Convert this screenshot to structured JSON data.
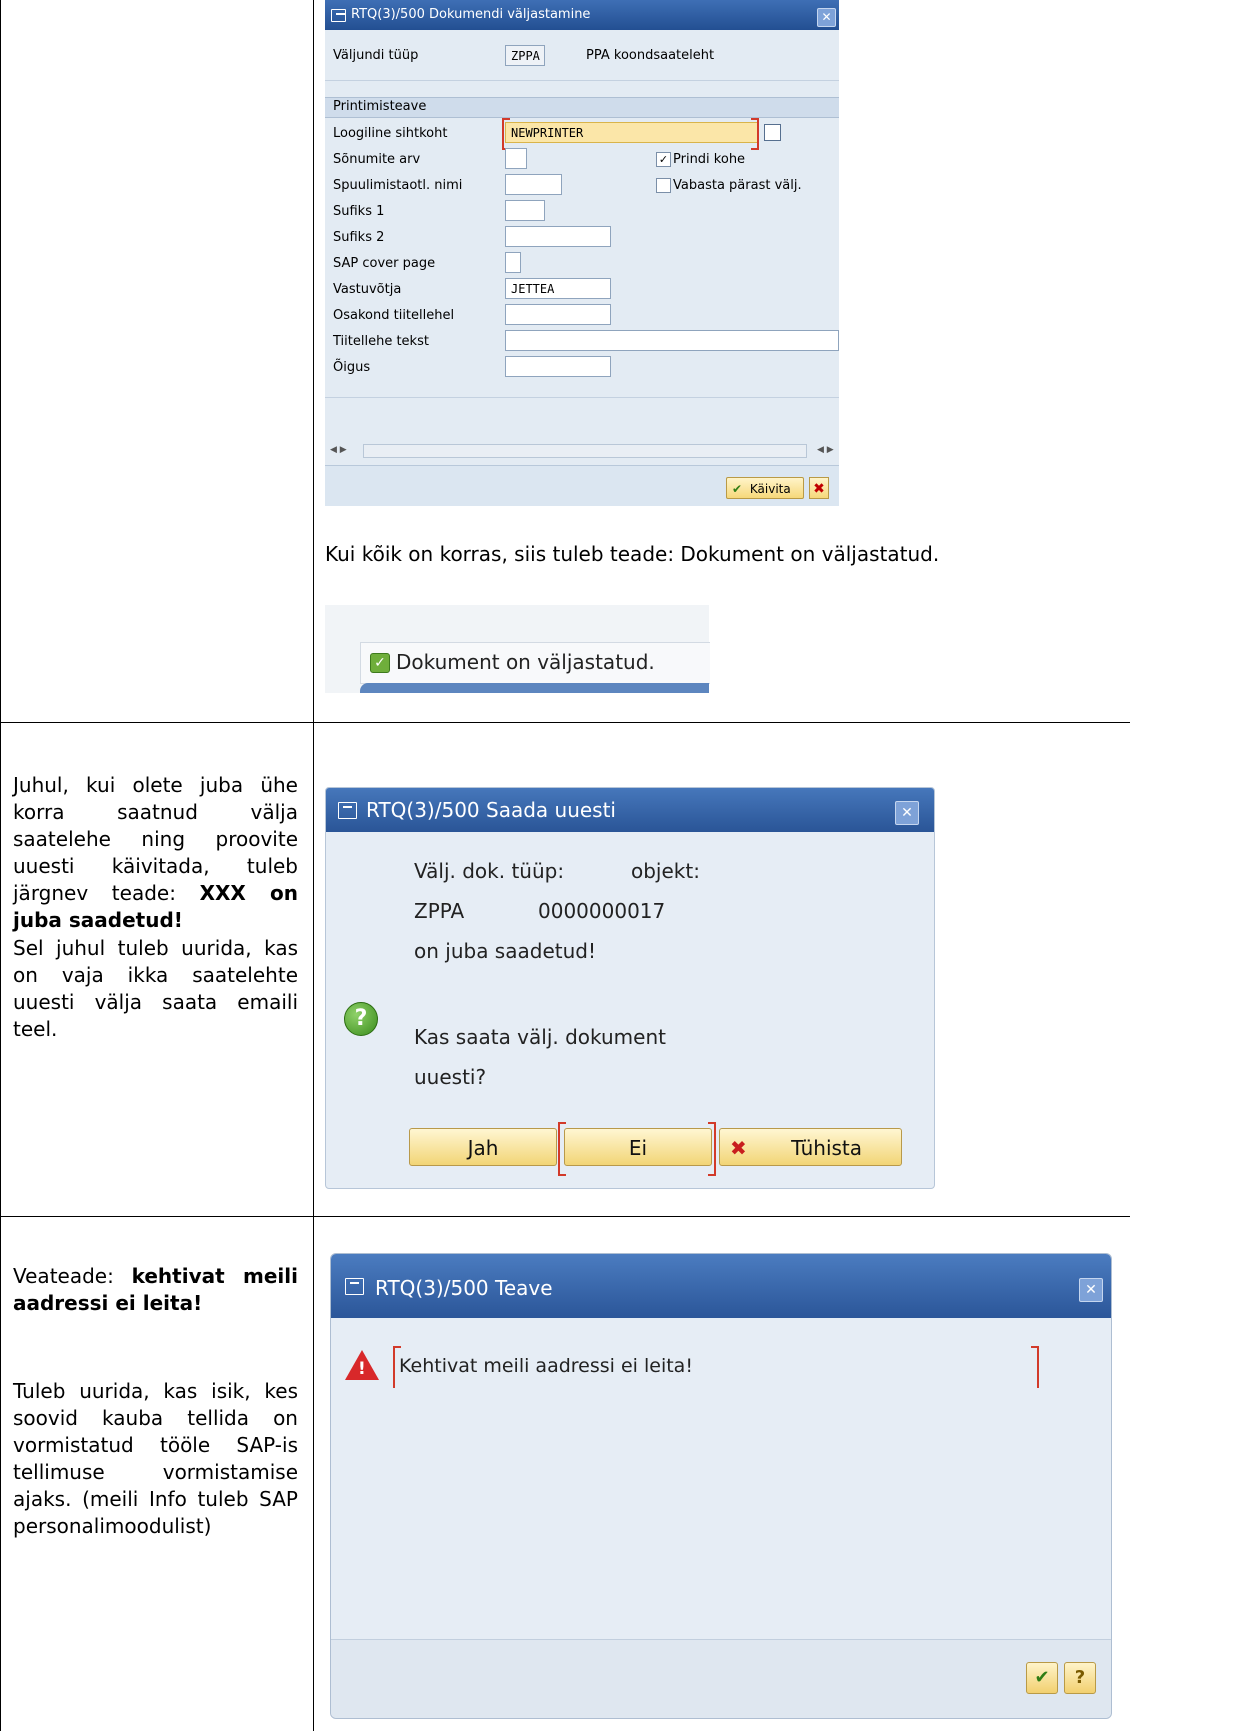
{
  "dialog_print": {
    "title": "RTQ(3)/500 Dokumendi väljastamine",
    "output_type_label": "Väljundi tüüp",
    "output_type_value": "ZPPA",
    "output_type_desc": "PPA koondsaateleht",
    "section_title": "Printimisteave",
    "fields": {
      "logical_dest_label": "Loogiline sihtkoht",
      "logical_dest_value": "NEWPRINTER",
      "num_messages_label": "Sõnumite arv",
      "spool_name_label": "Spuulimistaotl. nimi",
      "suffix1_label": "Sufiks 1",
      "suffix2_label": "Sufiks 2",
      "cover_page_label": "SAP cover page",
      "recipient_label": "Vastuvõtja",
      "recipient_value": "JETTEA",
      "department_label": "Osakond tiitellehel",
      "cover_text_label": "Tiitellehe tekst",
      "authorization_label": "Õigus"
    },
    "print_now_label": "Prindi kohe",
    "print_now_checked": true,
    "release_after_label": "Vabasta pärast välj.",
    "release_after_checked": false,
    "run_button": "Käivita"
  },
  "para_success": "Kui kõik on korras, siis tuleb teade: Dokument on väljastatud.",
  "status_message": "Dokument on väljastatud.",
  "row2_text": {
    "intro": "Juhul, kui olete juba ühe korra saatnud välja saatelehe ning proovite uuesti käivitada, tuleb järgnev teade:",
    "bold": "XXX on juba saadetud!",
    "followup": "Sel juhul tuleb uurida, kas on vaja ikka saatelehte uuesti välja saata emaili teel."
  },
  "dialog_resend": {
    "title": "RTQ(3)/500 Saada uuesti",
    "label_type": "Välj. dok. tüüp:",
    "label_object": "objekt:",
    "value_type": "ZPPA",
    "value_object": "0000000017",
    "already_sent": "on juba saadetud!",
    "question_line1": "Kas saata välj. dokument",
    "question_line2": "uuesti?",
    "btn_yes": "Jah",
    "btn_no": "Ei",
    "btn_cancel": "Tühista"
  },
  "row3_text": {
    "prefix": "Veateade:",
    "bold": "kehtivat meili aadressi ei leita!",
    "followup": "Tuleb uurida, kas isik, kes soovid kauba tellida on vormistatud tööle SAP-is tellimuse vormistamise ajaks. (meili Info tuleb SAP personalimoodulist)"
  },
  "dialog_info": {
    "title": "RTQ(3)/500 Teave",
    "message": "Kehtivat meili aadressi ei leita!"
  }
}
